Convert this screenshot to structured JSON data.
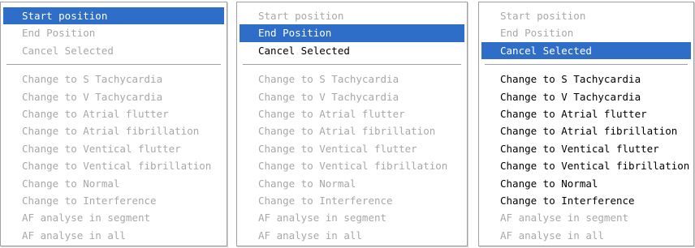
{
  "colors": {
    "highlight_background": "#2f6ec8",
    "highlight_text": "#ffffff",
    "enabled_text": "#000000",
    "disabled_text": "#a8a8a8"
  },
  "menus": [
    {
      "top_items": [
        {
          "label": "Start position",
          "state": "selected"
        },
        {
          "label": "End Position",
          "state": "disabled"
        },
        {
          "label": "Cancel Selected",
          "state": "disabled"
        }
      ],
      "bottom_items": [
        {
          "label": "Change to S Tachycardia",
          "state": "disabled"
        },
        {
          "label": "Change to V Tachycardia",
          "state": "disabled"
        },
        {
          "label": "Change to Atrial flutter",
          "state": "disabled"
        },
        {
          "label": "Change to Atrial fibrillation",
          "state": "disabled"
        },
        {
          "label": "Change to Ventical flutter",
          "state": "disabled"
        },
        {
          "label": "Change to Ventical fibrillation",
          "state": "disabled"
        },
        {
          "label": "Change to Normal",
          "state": "disabled"
        },
        {
          "label": "Change to Interference",
          "state": "disabled"
        },
        {
          "label": "AF analyse in segment",
          "state": "disabled"
        },
        {
          "label": "AF analyse in all",
          "state": "disabled"
        }
      ]
    },
    {
      "top_items": [
        {
          "label": "Start position",
          "state": "disabled"
        },
        {
          "label": "End Position",
          "state": "selected"
        },
        {
          "label": "Cancel Selected",
          "state": "enabled"
        }
      ],
      "bottom_items": [
        {
          "label": "Change to S Tachycardia",
          "state": "disabled"
        },
        {
          "label": "Change to V Tachycardia",
          "state": "disabled"
        },
        {
          "label": "Change to Atrial flutter",
          "state": "disabled"
        },
        {
          "label": "Change to Atrial fibrillation",
          "state": "disabled"
        },
        {
          "label": "Change to Ventical flutter",
          "state": "disabled"
        },
        {
          "label": "Change to Ventical fibrillation",
          "state": "disabled"
        },
        {
          "label": "Change to Normal",
          "state": "disabled"
        },
        {
          "label": "Change to Interference",
          "state": "disabled"
        },
        {
          "label": "AF analyse in segment",
          "state": "disabled"
        },
        {
          "label": "AF analyse in all",
          "state": "disabled"
        }
      ]
    },
    {
      "top_items": [
        {
          "label": "Start position",
          "state": "disabled"
        },
        {
          "label": "End Position",
          "state": "disabled"
        },
        {
          "label": "Cancel Selected",
          "state": "selected"
        }
      ],
      "bottom_items": [
        {
          "label": "Change to S Tachycardia",
          "state": "enabled"
        },
        {
          "label": "Change to V Tachycardia",
          "state": "enabled"
        },
        {
          "label": "Change to Atrial flutter",
          "state": "enabled"
        },
        {
          "label": "Change to Atrial fibrillation",
          "state": "enabled"
        },
        {
          "label": "Change to Ventical flutter",
          "state": "enabled"
        },
        {
          "label": "Change to Ventical fibrillation",
          "state": "enabled"
        },
        {
          "label": "Change to Normal",
          "state": "enabled"
        },
        {
          "label": "Change to Interference",
          "state": "enabled"
        },
        {
          "label": "AF analyse in segment",
          "state": "disabled"
        },
        {
          "label": "AF analyse in all",
          "state": "disabled"
        }
      ]
    }
  ]
}
